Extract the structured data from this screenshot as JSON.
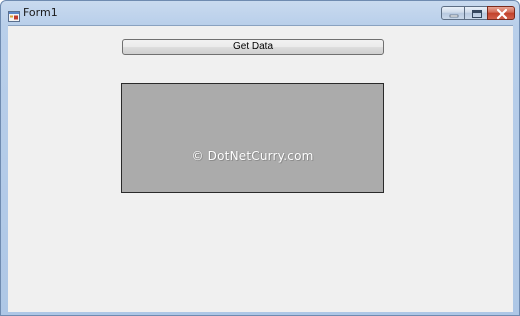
{
  "window": {
    "title": "Form1",
    "caption_buttons": [
      "minimize",
      "maximize",
      "close"
    ]
  },
  "form": {
    "get_data_button_label": "Get Data",
    "picture_watermark": "© DotNetCurry.com",
    "picture_background": "#ababab"
  },
  "colors": {
    "form_background": "#f0f0f0",
    "close_button": "#c2412a"
  },
  "icons": {
    "app": "form-app-icon",
    "minimize": "minimize-icon",
    "maximize": "maximize-icon",
    "close": "close-icon"
  }
}
